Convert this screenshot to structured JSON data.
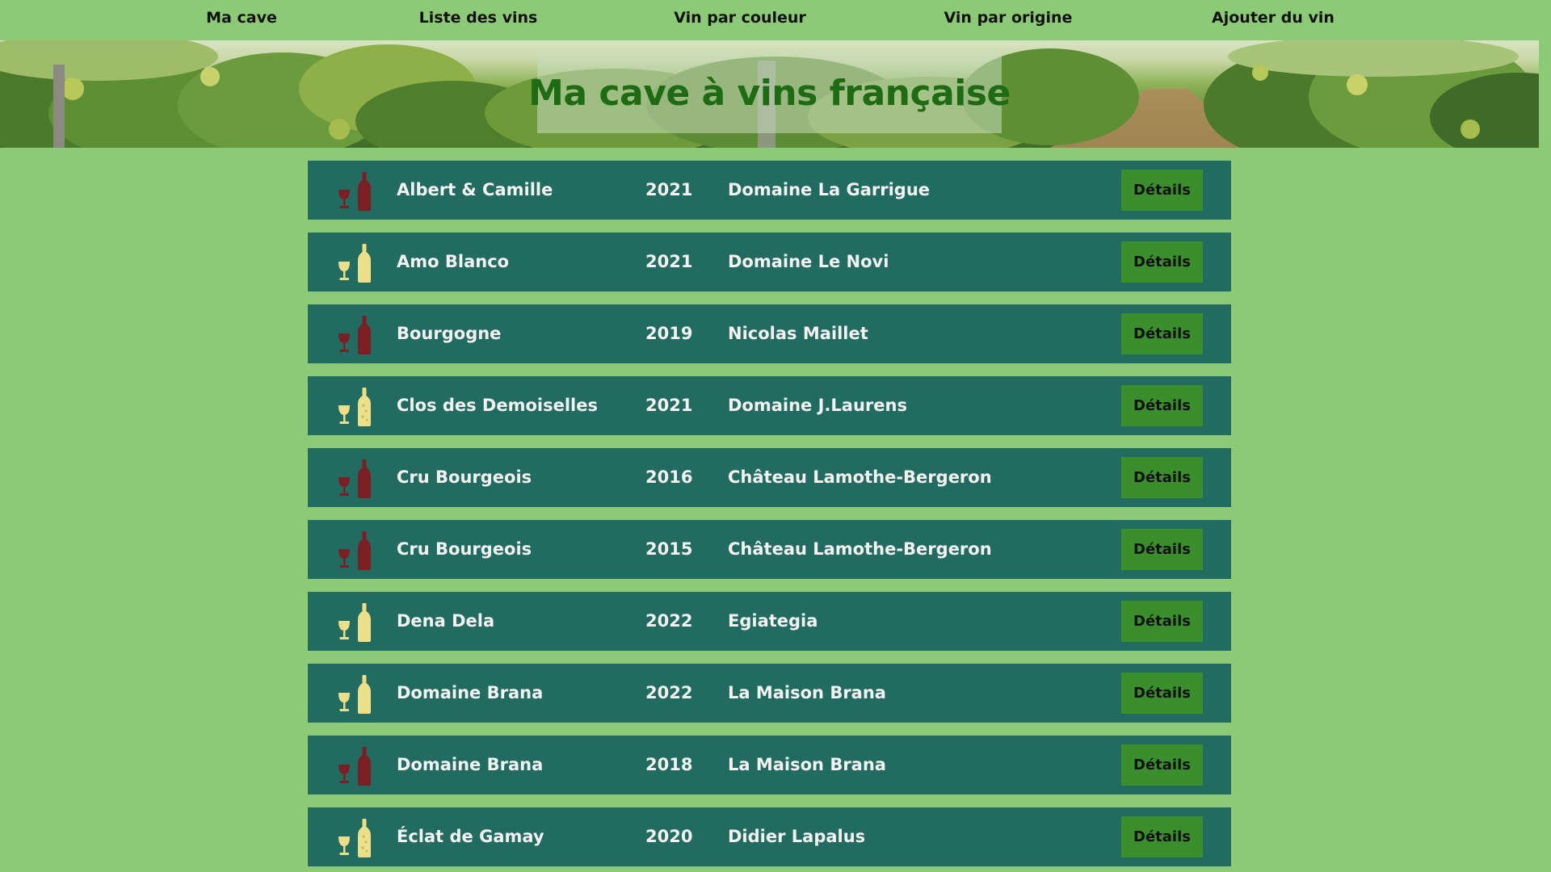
{
  "nav": {
    "items": [
      {
        "label": "Ma cave"
      },
      {
        "label": "Liste des vins"
      },
      {
        "label": "Vin par couleur"
      },
      {
        "label": "Vin par origine"
      },
      {
        "label": "Ajouter du vin"
      }
    ]
  },
  "banner": {
    "title": "Ma cave à vins française"
  },
  "colors": {
    "page_background": "#8dca77",
    "row_background": "#216b61",
    "button_background": "#3a8e2b",
    "title_color": "#1e6b14",
    "red_wine": "#7a1f24",
    "white_wine": "#ecdf8a"
  },
  "wines": [
    {
      "name": "Albert & Camille",
      "year": "2021",
      "producer": "Domaine La Garrigue",
      "color": "red",
      "icon": "red-wine-icon",
      "button": "Détails"
    },
    {
      "name": "Amo Blanco",
      "year": "2021",
      "producer": "Domaine Le Novi",
      "color": "white",
      "icon": "white-wine-icon",
      "button": "Détails"
    },
    {
      "name": "Bourgogne",
      "year": "2019",
      "producer": "Nicolas Maillet",
      "color": "red",
      "icon": "red-wine-icon",
      "button": "Détails"
    },
    {
      "name": "Clos des Demoiselles",
      "year": "2021",
      "producer": "Domaine J.Laurens",
      "color": "sparkling",
      "icon": "sparkling-wine-icon",
      "button": "Détails"
    },
    {
      "name": "Cru Bourgeois",
      "year": "2016",
      "producer": "Château Lamothe-Bergeron",
      "color": "red",
      "icon": "red-wine-icon",
      "button": "Détails"
    },
    {
      "name": "Cru Bourgeois",
      "year": "2015",
      "producer": "Château Lamothe-Bergeron",
      "color": "red",
      "icon": "red-wine-icon",
      "button": "Détails"
    },
    {
      "name": "Dena Dela",
      "year": "2022",
      "producer": "Egiategia",
      "color": "white",
      "icon": "white-wine-icon",
      "button": "Détails"
    },
    {
      "name": "Domaine Brana",
      "year": "2022",
      "producer": "La Maison Brana",
      "color": "white",
      "icon": "white-wine-icon",
      "button": "Détails"
    },
    {
      "name": "Domaine Brana",
      "year": "2018",
      "producer": "La Maison Brana",
      "color": "red",
      "icon": "red-wine-icon",
      "button": "Détails"
    },
    {
      "name": "Éclat de Gamay",
      "year": "2020",
      "producer": "Didier Lapalus",
      "color": "sparkling",
      "icon": "sparkling-wine-icon",
      "button": "Détails"
    }
  ]
}
